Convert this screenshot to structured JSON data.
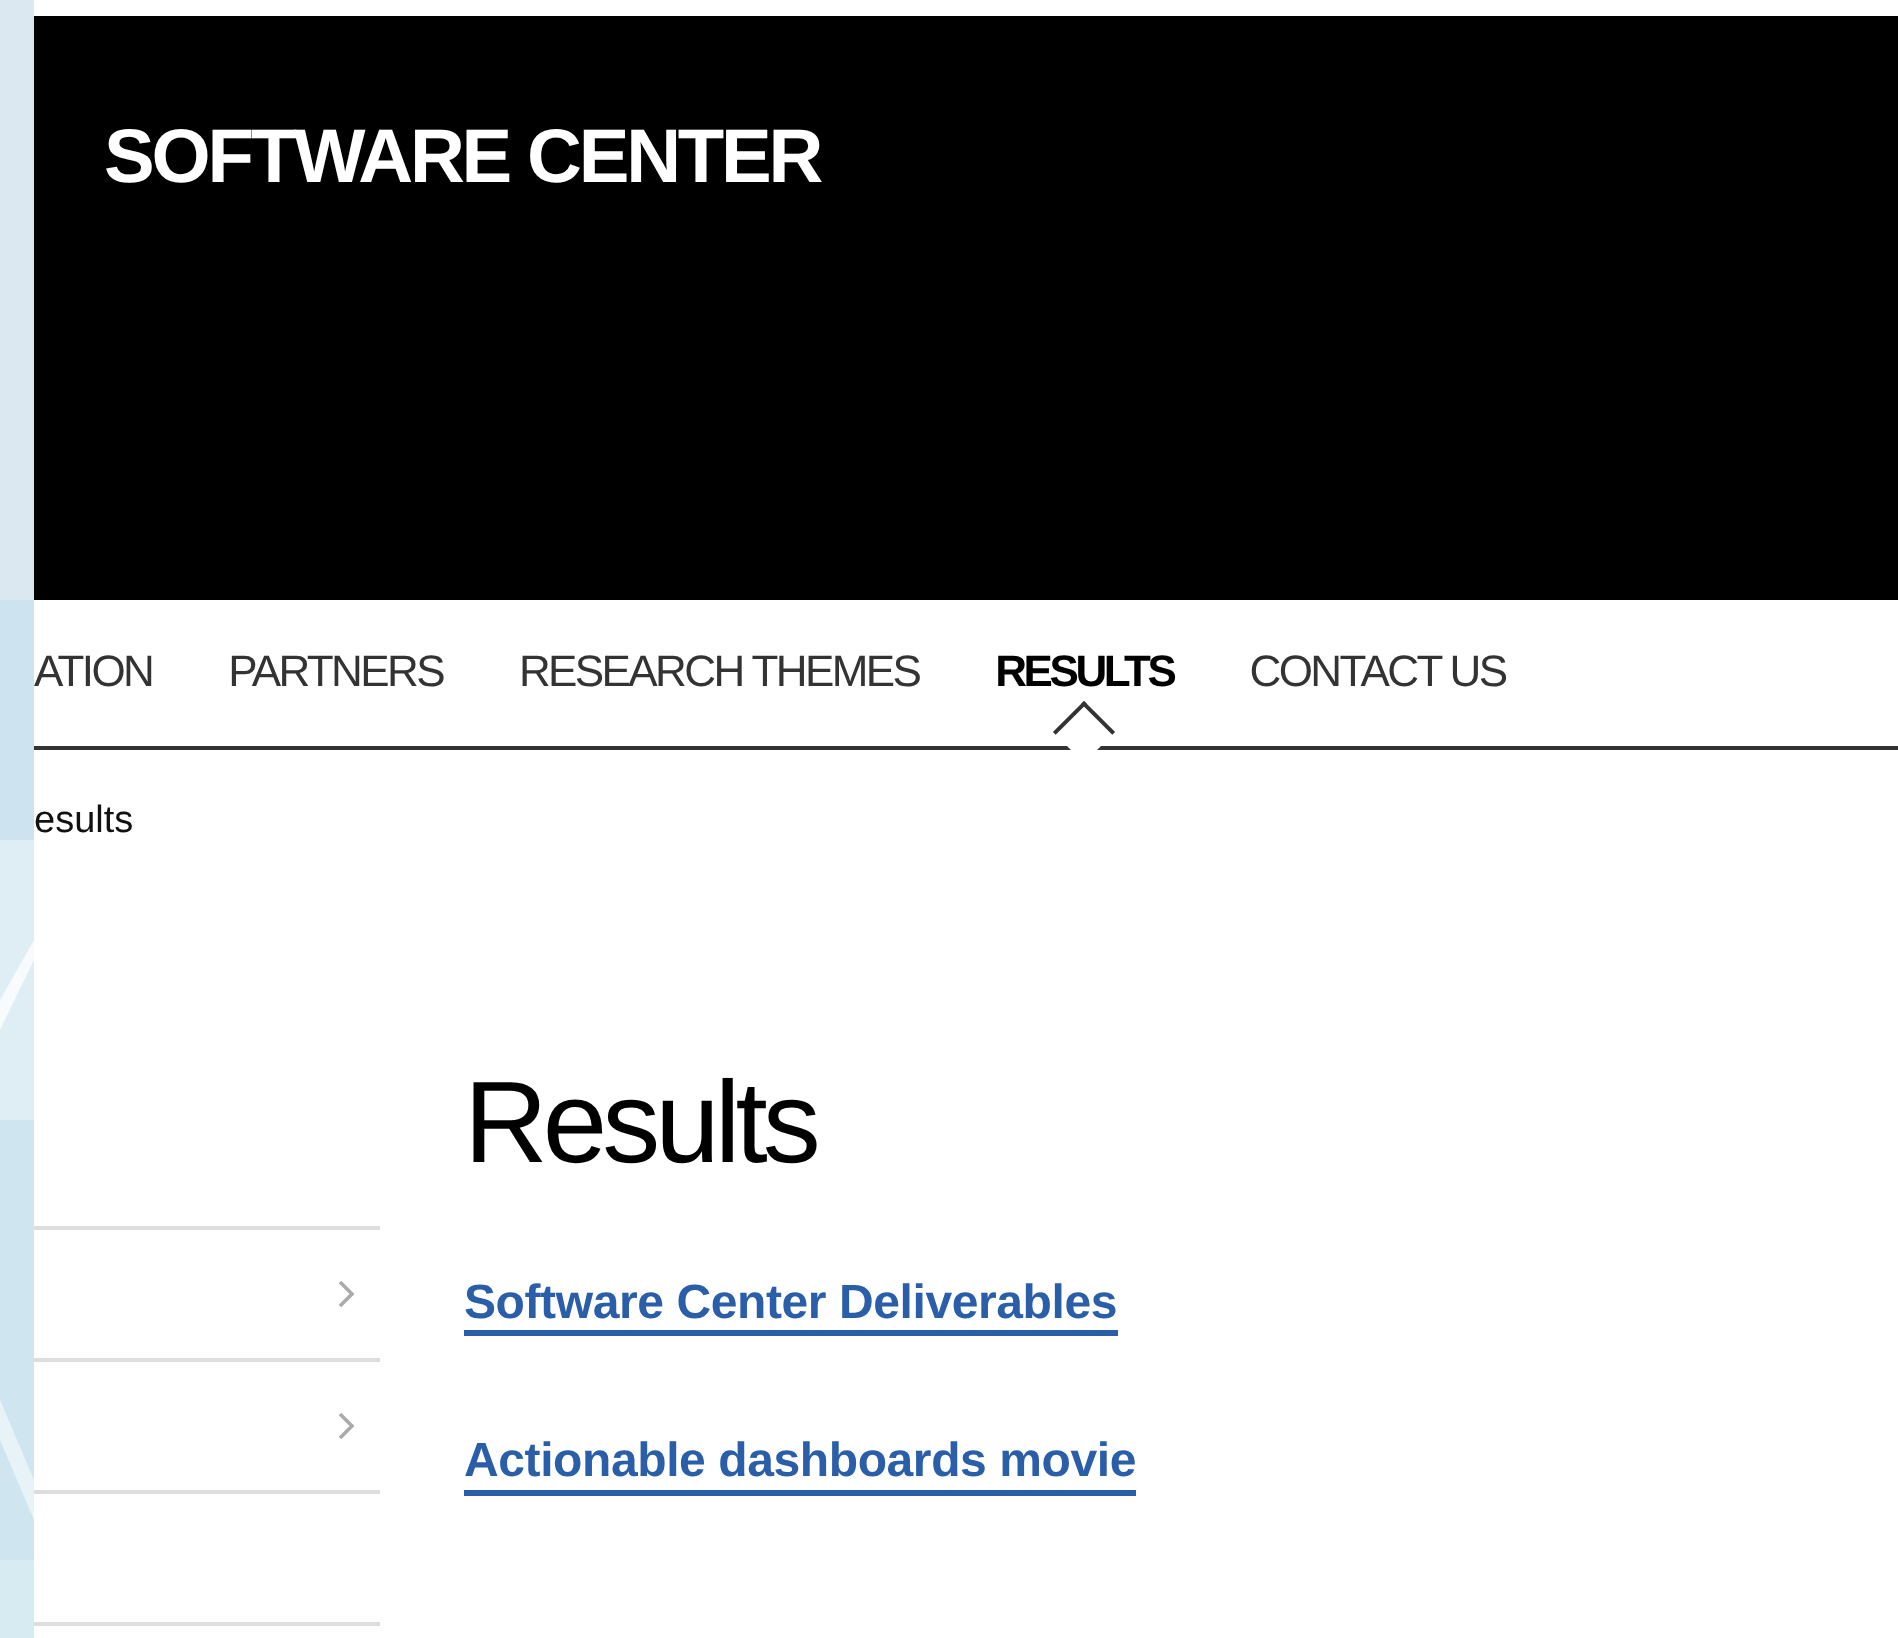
{
  "header": {
    "title": "SOFTWARE CENTER"
  },
  "nav": [
    {
      "label": "ATION",
      "selected": false
    },
    {
      "label": "PARTNERS",
      "selected": false
    },
    {
      "label": "RESEARCH THEMES",
      "selected": false
    },
    {
      "label": "RESULTS",
      "selected": true
    },
    {
      "label": "CONTACT US",
      "selected": false
    }
  ],
  "breadcrumb": "esults",
  "sidebar": {
    "items": [
      {
        "expandable": true
      },
      {
        "expandable": true
      },
      {
        "expandable": false
      }
    ]
  },
  "content": {
    "heading": "Results",
    "links": [
      "Software Center Deliverables",
      "Actionable dashboards movie"
    ]
  }
}
